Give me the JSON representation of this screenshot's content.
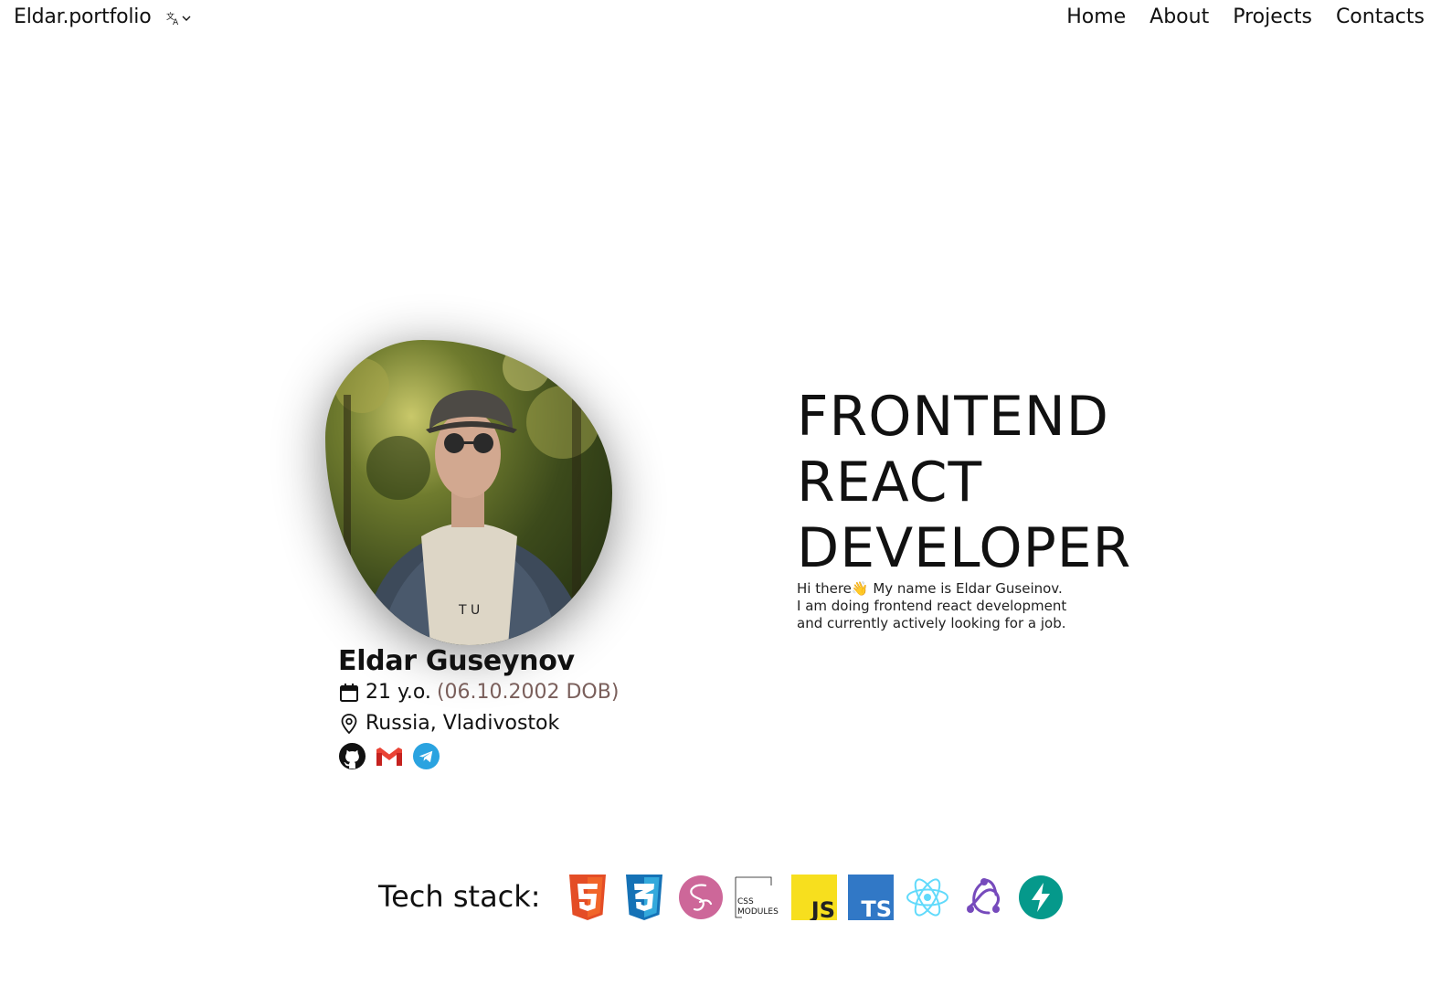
{
  "header": {
    "logo": "Eldar.portfolio",
    "lang_icon": "translate-icon",
    "nav": [
      "Home",
      "About",
      "Projects",
      "Contacts"
    ]
  },
  "profile": {
    "photo_icon": "profile-photo",
    "name": "Eldar Guseynov",
    "age": "21 y.o.",
    "dob": "(06.10.2002 DOB)",
    "location": "Russia, Vladivostok",
    "socials": [
      "github-icon",
      "gmail-icon",
      "telegram-icon"
    ]
  },
  "hero": {
    "title_lines": [
      "FRONTEND",
      "REACT",
      "DEVELOPER"
    ],
    "bio_line1": "Hi there👋 My name is Eldar Guseinov.",
    "bio_line2": "I am doing frontend react development",
    "bio_line3": "and currently actively looking for a job."
  },
  "tech_stack": {
    "label": "Tech stack:",
    "icons": [
      "html5-icon",
      "css3-icon",
      "sass-icon",
      "css-modules-icon",
      "javascript-icon",
      "typescript-icon",
      "react-icon",
      "redux-icon",
      "fastapi-icon"
    ],
    "css_modules_text_1": "CSS",
    "css_modules_text_2": "MODULES",
    "js_text": "JS",
    "ts_text": "TS"
  },
  "colors": {
    "dob": "#7a5f5b",
    "html5": "#e44d26",
    "css3": "#1572b6",
    "sass": "#cd6799",
    "js": "#f7df1e",
    "ts": "#3178c6",
    "react": "#61dafb",
    "redux": "#764abc",
    "fastapi": "#05998b",
    "telegram": "#2aa3e0",
    "gmail": "#ea4335"
  }
}
